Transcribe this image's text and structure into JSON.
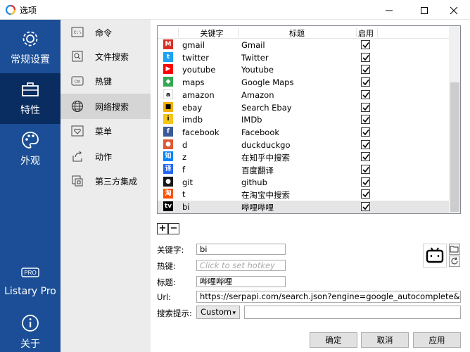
{
  "window": {
    "title": "选项"
  },
  "nav": [
    {
      "label": "常规设置",
      "icon": "gear-icon"
    },
    {
      "label": "特性",
      "icon": "toolbox-icon"
    },
    {
      "label": "外观",
      "icon": "palette-icon"
    },
    {
      "label": "Listary Pro",
      "icon": "pro-badge-icon"
    },
    {
      "label": "关于",
      "icon": "info-icon"
    }
  ],
  "subnav": [
    {
      "label": "命令",
      "icon": "command-icon"
    },
    {
      "label": "文件搜索",
      "icon": "file-search-icon"
    },
    {
      "label": "热键",
      "icon": "hotkey-icon"
    },
    {
      "label": "网络搜索",
      "icon": "globe-icon"
    },
    {
      "label": "菜单",
      "icon": "menu-heart-icon"
    },
    {
      "label": "动作",
      "icon": "action-icon"
    },
    {
      "label": "第三方集成",
      "icon": "integration-icon"
    }
  ],
  "table": {
    "headers": {
      "keyword": "关键字",
      "title": "标题",
      "enabled": "启用"
    },
    "rows": [
      {
        "keyword": "gmail",
        "title": "Gmail",
        "icon": "gmail-icon",
        "color": "#d93025",
        "glyph": "M",
        "enabled": true
      },
      {
        "keyword": "twitter",
        "title": "Twitter",
        "icon": "twitter-icon",
        "color": "#1da1f2",
        "glyph": "t",
        "enabled": true
      },
      {
        "keyword": "youtube",
        "title": "Youtube",
        "icon": "youtube-icon",
        "color": "#ff0000",
        "glyph": "▶",
        "enabled": true
      },
      {
        "keyword": "maps",
        "title": "Google Maps",
        "icon": "google-maps-icon",
        "color": "#34a853",
        "glyph": "◆",
        "enabled": true
      },
      {
        "keyword": "amazon",
        "title": "Amazon",
        "icon": "amazon-icon",
        "color": "#ffffff",
        "glyph": "a",
        "enabled": true
      },
      {
        "keyword": "ebay",
        "title": "Search Ebay",
        "icon": "ebay-bag-icon",
        "color": "#f5af02",
        "glyph": "■",
        "enabled": true
      },
      {
        "keyword": "imdb",
        "title": "IMDb",
        "icon": "imdb-icon",
        "color": "#f5c518",
        "glyph": "i",
        "enabled": true
      },
      {
        "keyword": "facebook",
        "title": "Facebook",
        "icon": "facebook-icon",
        "color": "#3b5998",
        "glyph": "f",
        "enabled": true
      },
      {
        "keyword": "d",
        "title": "duckduckgo",
        "icon": "duckduckgo-icon",
        "color": "#de5833",
        "glyph": "●",
        "enabled": true
      },
      {
        "keyword": "z",
        "title": "在知乎中搜索",
        "icon": "zhihu-icon",
        "color": "#0084ff",
        "glyph": "知",
        "enabled": true
      },
      {
        "keyword": "f",
        "title": "百度翻译",
        "icon": "baidu-translate-icon",
        "color": "#2468f2",
        "glyph": "译",
        "enabled": true
      },
      {
        "keyword": "git",
        "title": "github",
        "icon": "github-icon",
        "color": "#181717",
        "glyph": "●",
        "enabled": true
      },
      {
        "keyword": "t",
        "title": "在淘宝中搜索",
        "icon": "taobao-icon",
        "color": "#ff5000",
        "glyph": "淘",
        "enabled": true
      },
      {
        "keyword": "bi",
        "title": "哔哩哔哩",
        "icon": "bilibili-icon",
        "color": "#000000",
        "glyph": "tv",
        "enabled": true
      }
    ]
  },
  "controls": {
    "add": "+",
    "remove": "−"
  },
  "form": {
    "keyword_label": "关键字:",
    "keyword_value": "bi",
    "hotkey_label": "热键:",
    "hotkey_placeholder": "Click to set hotkey",
    "title_label": "标题:",
    "title_value": "哔哩哔哩",
    "url_label": "Url:",
    "url_value": "https://serpapi.com/search.json?engine=google_autocomplete&q=coffee",
    "hint_label": "搜索提示:",
    "hint_select": "Custom",
    "hint_value": ""
  },
  "buttons": {
    "ok": "确定",
    "cancel": "取消",
    "apply": "应用"
  },
  "colors": {
    "nav_bg": "#1b4e96",
    "nav_active": "#0a2d61",
    "subnav_bg": "#ececec"
  }
}
